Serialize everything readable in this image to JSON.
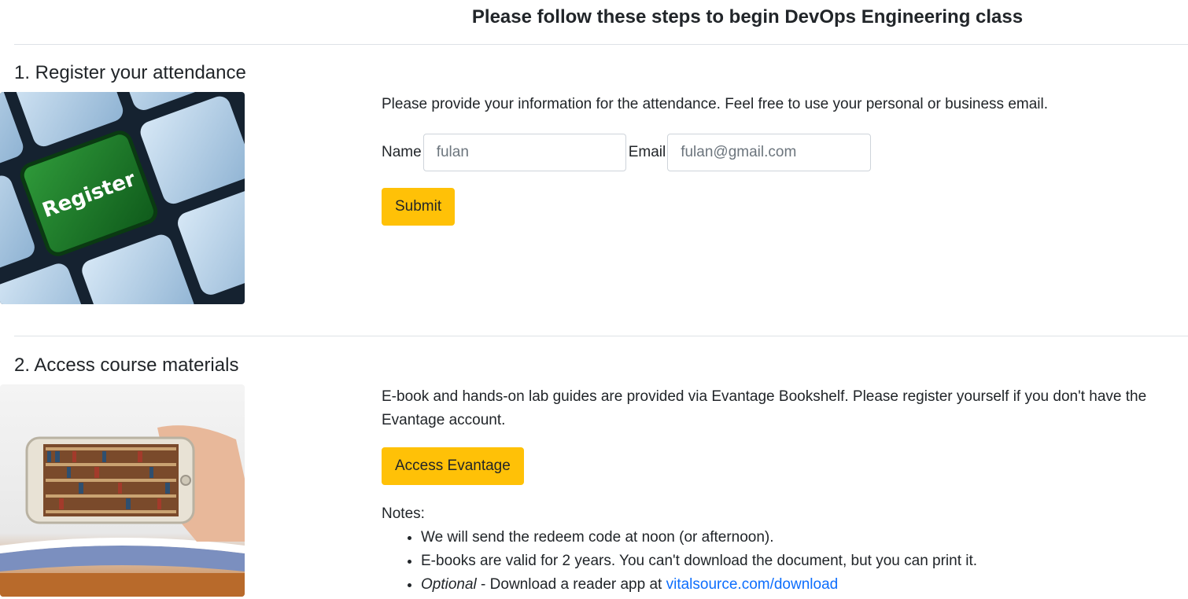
{
  "header": {
    "title": "Please follow these steps to begin DevOps Engineering class"
  },
  "steps": {
    "register": {
      "heading": "1. Register your attendance",
      "image_label": "Register",
      "description": "Please provide your information for the attendance. Feel free to use your personal or business email.",
      "name_label": "Name",
      "name_placeholder": "fulan",
      "email_label": "Email",
      "email_placeholder": "fulan@gmail.com",
      "submit_label": "Submit"
    },
    "materials": {
      "heading": "2. Access course materials",
      "description": "E-book and hands-on lab guides are provided via Evantage Bookshelf. Please register yourself if you don't have the Evantage account.",
      "button_label": "Access Evantage",
      "notes_label": "Notes:",
      "notes": [
        "We will send the redeem code at noon (or afternoon).",
        "E-books are valid for 2 years. You can't download the document, but you can print it."
      ],
      "optional_label": "Optional",
      "optional_text": " - Download a reader app at ",
      "optional_link": "vitalsource.com/download"
    }
  },
  "colors": {
    "accent": "#ffc107",
    "link": "#0d6efd",
    "divider": "#dee2e6",
    "key_green": "#1f7a2b"
  }
}
